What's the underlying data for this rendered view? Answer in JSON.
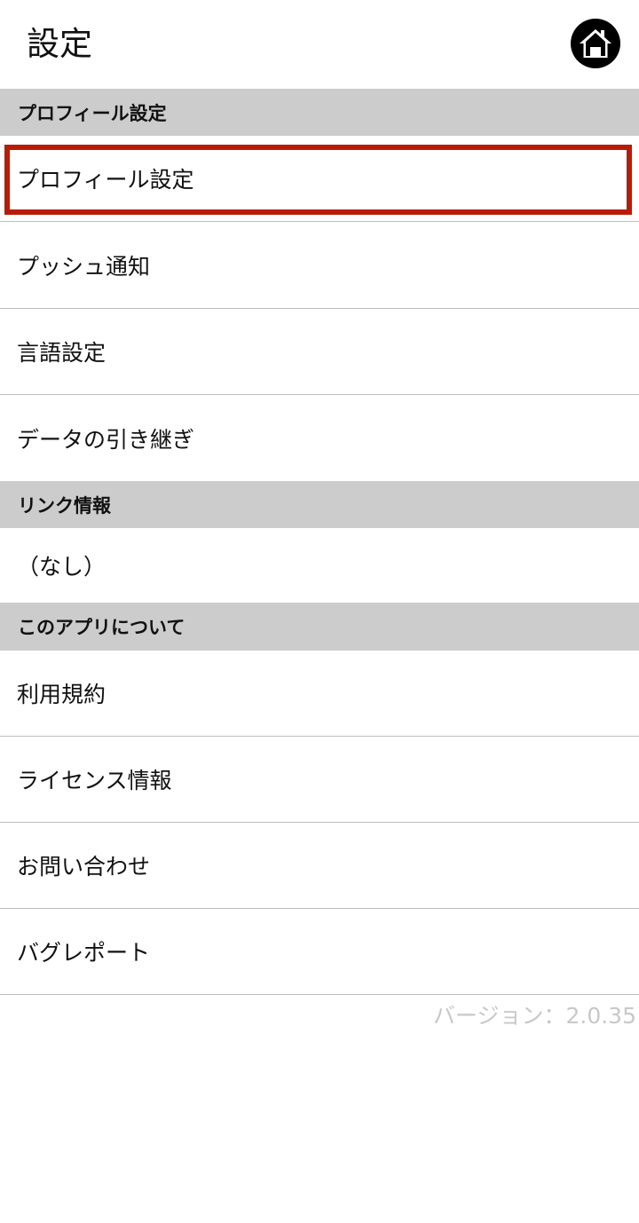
{
  "header": {
    "title": "設定",
    "home_icon": "home-icon"
  },
  "sections": {
    "profile": {
      "title": "プロフィール設定",
      "items": [
        "プロフィール設定",
        "プッシュ通知",
        "言語設定",
        "データの引き継ぎ"
      ]
    },
    "links": {
      "title": "リンク情報",
      "empty_text": "（なし）"
    },
    "about": {
      "title": "このアプリについて",
      "items": [
        "利用規約",
        "ライセンス情報",
        "お問い合わせ",
        "バグレポート"
      ]
    }
  },
  "version_text": "バージョン：2.0.35",
  "colors": {
    "section_bg": "#cccccc",
    "highlight": "#b81c08",
    "version_text": "#c8c8c8"
  }
}
